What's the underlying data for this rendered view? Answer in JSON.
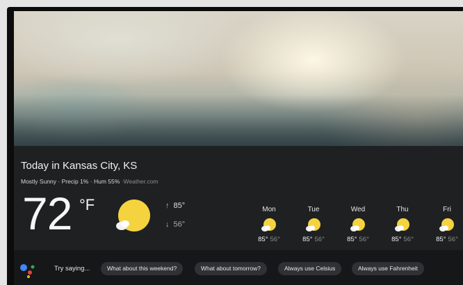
{
  "location_title": "Today in Kansas City, KS",
  "conditions": {
    "summary": "Mostly Sunny",
    "precip": "Precip 1%",
    "humidity": "Hum 55%",
    "source": "Weather.com",
    "separator": "·"
  },
  "current": {
    "temperature": "72",
    "unit": "°F",
    "icon": "sun-icon",
    "high": "85°",
    "low": "56°",
    "high_arrow": "↑",
    "low_arrow": "↓"
  },
  "forecast": [
    {
      "day": "Mon",
      "high": "85°",
      "low": "56°",
      "icon": "partly-sunny-icon"
    },
    {
      "day": "Tue",
      "high": "85°",
      "low": "56°",
      "icon": "partly-sunny-icon"
    },
    {
      "day": "Wed",
      "high": "85°",
      "low": "56°",
      "icon": "partly-sunny-icon"
    },
    {
      "day": "Thu",
      "high": "85°",
      "low": "56°",
      "icon": "partly-sunny-icon"
    },
    {
      "day": "Fri",
      "high": "85°",
      "low": "56°",
      "icon": "partly-sunny-icon"
    }
  ],
  "assistant": {
    "icon": "google-assistant-icon",
    "prompt": "Try saying...",
    "suggestions": [
      "What about this weekend?",
      "What about tomorrow?",
      "Always use Celsius",
      "Always use Fahrenheit"
    ]
  },
  "colors": {
    "panel_bg": "#1f2022",
    "sun": "#f4d33f",
    "assistant_blue": "#4285f4",
    "assistant_red": "#ea4335",
    "assistant_yellow": "#fbbc05",
    "assistant_green": "#34a853"
  }
}
